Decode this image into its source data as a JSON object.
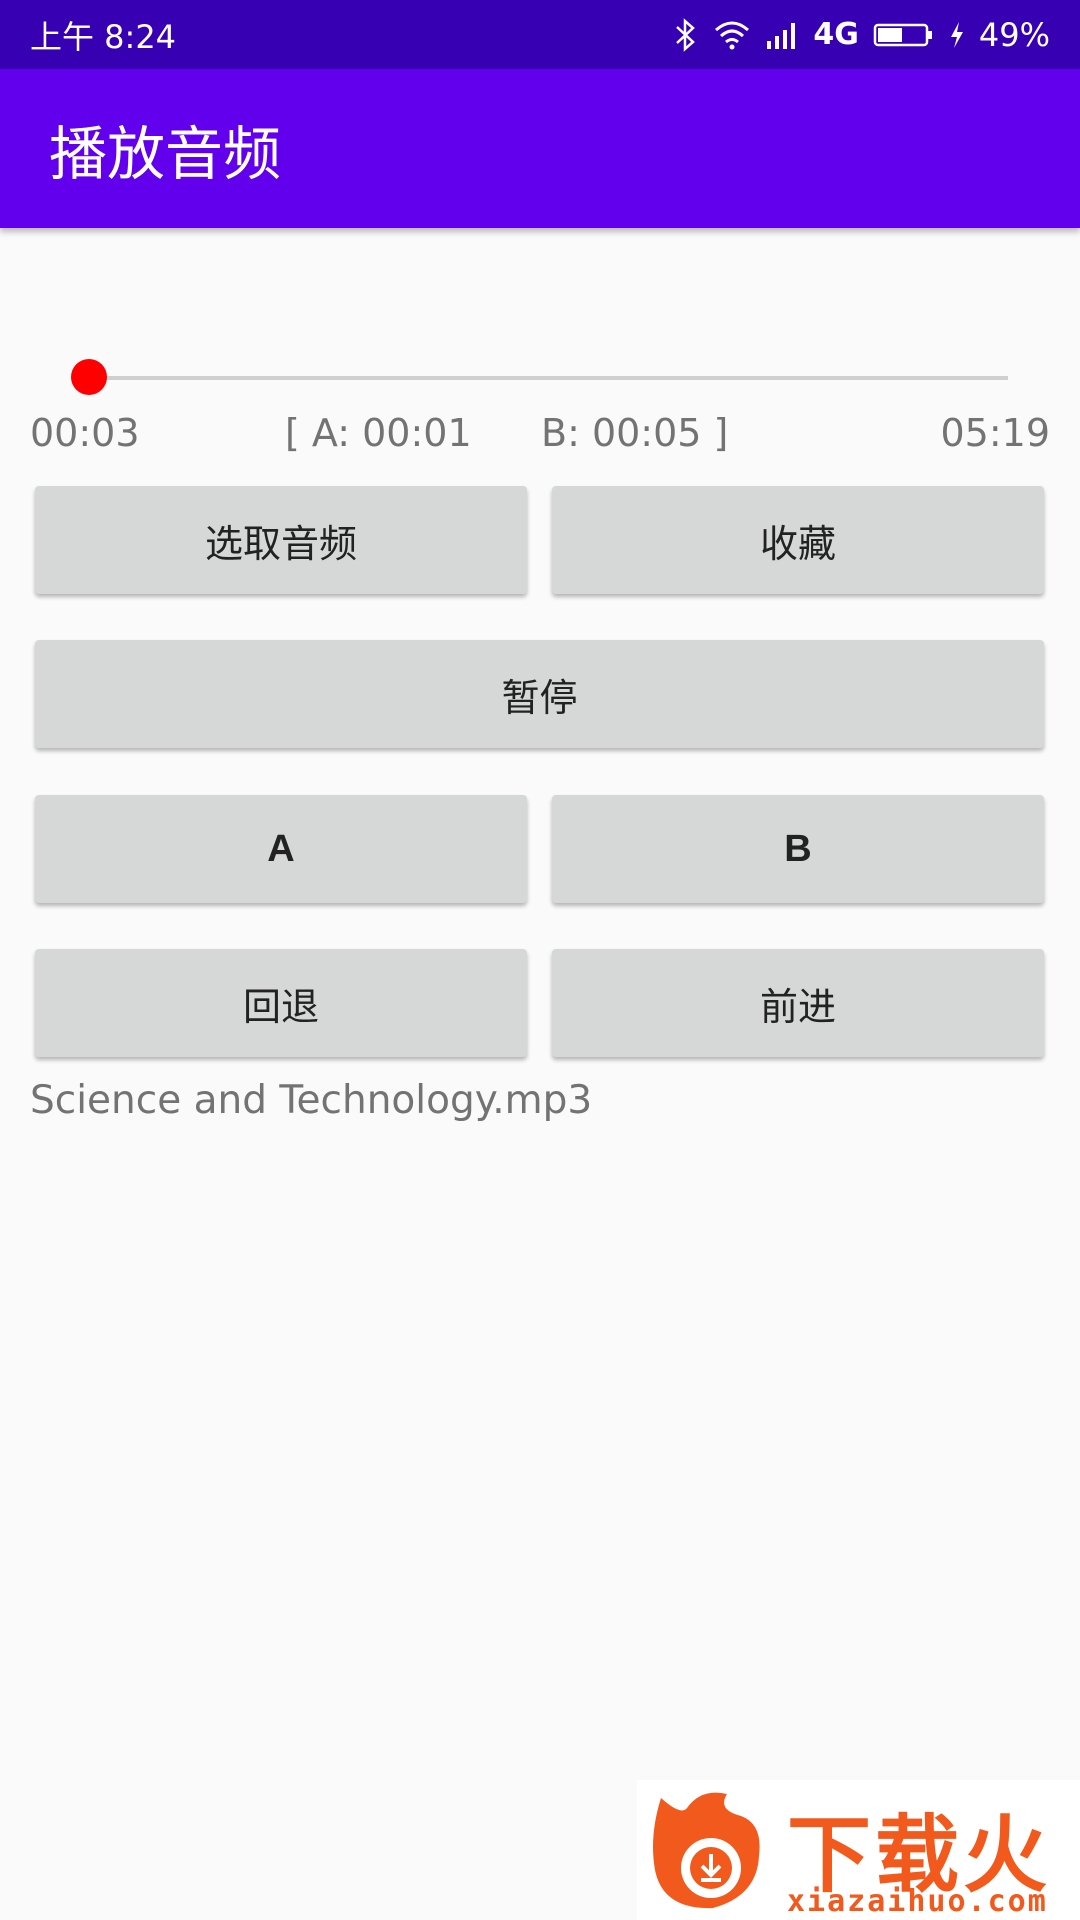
{
  "status_bar": {
    "time": "上午 8:24",
    "network": "4G",
    "battery": "49%"
  },
  "app_bar": {
    "title": "播放音频"
  },
  "player": {
    "position": "00:03",
    "point_a": "[ A: 00:01",
    "point_b": "B: 00:05 ]",
    "duration": "05:19",
    "progress_fraction": 0.0094
  },
  "buttons": {
    "select_audio": "选取音频",
    "favorite": "收藏",
    "pause": "暂停",
    "a": "A",
    "b": "B",
    "rewind": "回退",
    "forward": "前进"
  },
  "file_name": "Science and Technology.mp3",
  "watermark": {
    "text": "下载火",
    "url": "xiazaihuo.com"
  },
  "colors": {
    "status_bar": "#3700b3",
    "app_bar": "#6200ee",
    "seek_thumb": "#ff0000",
    "button": "#d6d7d7",
    "watermark": "#f25a1d"
  }
}
